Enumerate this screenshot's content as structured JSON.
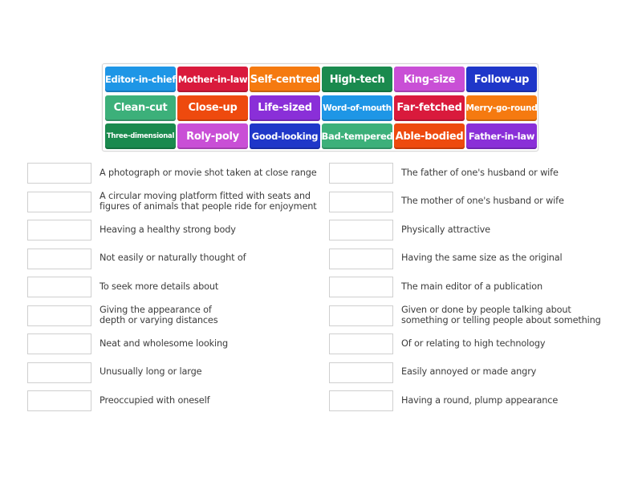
{
  "word_bank": {
    "tiles": [
      {
        "label": "Editor-in-chief",
        "color": "#1e96e6",
        "size": "m"
      },
      {
        "label": "Mother-in-law",
        "color": "#d91a3c",
        "size": "m"
      },
      {
        "label": "Self-centred",
        "color": "#f57a10",
        "size": "l"
      },
      {
        "label": "High-tech",
        "color": "#1a8a4e",
        "size": "l"
      },
      {
        "label": "King-size",
        "color": "#c94fd6",
        "size": "l"
      },
      {
        "label": "Follow-up",
        "color": "#1f37c9",
        "size": "l"
      },
      {
        "label": "Clean-cut",
        "color": "#3cb07a",
        "size": "l"
      },
      {
        "label": "Close-up",
        "color": "#ee4a0e",
        "size": "l"
      },
      {
        "label": "Life-sized",
        "color": "#8a2fd8",
        "size": "l"
      },
      {
        "label": "Word-of-mouth",
        "color": "#1e96e6",
        "size": "s"
      },
      {
        "label": "Far-fetched",
        "color": "#d91a3c",
        "size": "l"
      },
      {
        "label": "Merry-go-round",
        "color": "#f57a10",
        "size": "s"
      },
      {
        "label": "Three-dimensional",
        "color": "#1a8a4e",
        "size": "xs"
      },
      {
        "label": "Roly-poly",
        "color": "#c94fd6",
        "size": "l"
      },
      {
        "label": "Good-looking",
        "color": "#1f37c9",
        "size": "m"
      },
      {
        "label": "Bad-tempered",
        "color": "#3cb07a",
        "size": "m"
      },
      {
        "label": "Able-bodied",
        "color": "#ee4a0e",
        "size": "l"
      },
      {
        "label": "Father-in-law",
        "color": "#8a2fd8",
        "size": "m"
      }
    ]
  },
  "definitions": {
    "left": [
      {
        "text": "A photograph or movie shot taken at close range",
        "answer": ""
      },
      {
        "text": "A circular moving platform fitted with seats and\nfigures of animals that people ride for enjoyment",
        "answer": ""
      },
      {
        "text": "Heaving a healthy strong body",
        "answer": ""
      },
      {
        "text": "Not easily or naturally thought of",
        "answer": ""
      },
      {
        "text": "To seek more details about",
        "answer": ""
      },
      {
        "text": "Giving the appearance of\ndepth or varying distances",
        "answer": ""
      },
      {
        "text": "Neat and wholesome looking",
        "answer": ""
      },
      {
        "text": "Unusually long or large",
        "answer": ""
      },
      {
        "text": "Preoccupied with oneself",
        "answer": ""
      }
    ],
    "right": [
      {
        "text": "The father of one's husband or wife",
        "answer": ""
      },
      {
        "text": "The mother of one's husband or wife",
        "answer": ""
      },
      {
        "text": "Physically attractive",
        "answer": ""
      },
      {
        "text": "Having the same size as the original",
        "answer": ""
      },
      {
        "text": "The main editor of a publication",
        "answer": ""
      },
      {
        "text": "Given or done by people talking about\nsomething or telling people about something",
        "answer": ""
      },
      {
        "text": "Of or relating to high technology",
        "answer": ""
      },
      {
        "text": "Easily annoyed or made angry",
        "answer": ""
      },
      {
        "text": "Having a round, plump appearance",
        "answer": ""
      }
    ]
  }
}
